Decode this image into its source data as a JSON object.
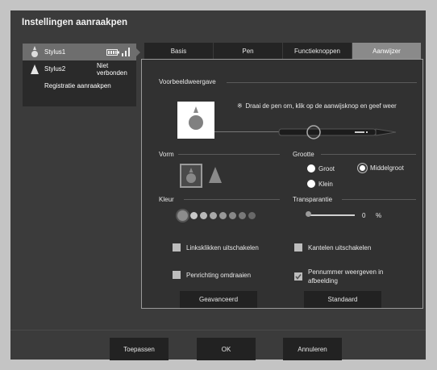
{
  "window": {
    "title": "Instellingen aanraakpen"
  },
  "sidebar": {
    "items": [
      {
        "label": "Stylus1",
        "status": ""
      },
      {
        "label": "Stylus2",
        "status": "Niet verbonden"
      },
      {
        "label": "Registratie aanraakpen",
        "status": ""
      }
    ]
  },
  "tabs": [
    {
      "label": "Basis"
    },
    {
      "label": "Pen"
    },
    {
      "label": "Functieknoppen"
    },
    {
      "label": "Aanwijzer"
    }
  ],
  "preview": {
    "heading": "Voorbeeldweergave",
    "hint": "Draai de pen om, klik op de aanwijsknop en geef weer"
  },
  "shape": {
    "heading": "Vorm"
  },
  "size": {
    "heading": "Grootte",
    "options": [
      "Groot",
      "Middelgroot",
      "Klein"
    ],
    "selected": "Middelgroot"
  },
  "color": {
    "heading": "Kleur",
    "swatches": [
      "#8c8c8c",
      "#c8c8c8",
      "#b8b8b8",
      "#a8a8a8",
      "#989898",
      "#888888",
      "#787878",
      "#686868"
    ]
  },
  "transparency": {
    "heading": "Transparantie",
    "value": "0",
    "unit": "%"
  },
  "options": {
    "left_click": "Linksklikken uitschakelen",
    "tilt": "Kantelen uitschakelen",
    "reverse": "Penrichting omdraaien",
    "pen_number": "Pennummer weergeven in afbeelding"
  },
  "buttons": {
    "advanced": "Geavanceerd",
    "default": "Standaard",
    "apply": "Toepassen",
    "ok": "OK",
    "cancel": "Annuleren"
  }
}
